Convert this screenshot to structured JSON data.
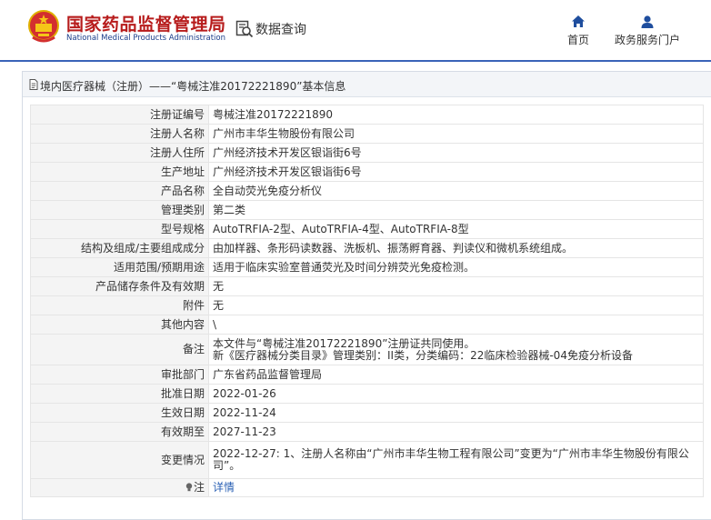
{
  "header": {
    "site_title": "国家药品监督管理局",
    "site_subtitle": "National Medical Products Administration",
    "query_label": "数据查询",
    "nav": [
      {
        "label": "首页",
        "icon": "home-icon"
      },
      {
        "label": "政务服务门户",
        "icon": "user-icon"
      }
    ],
    "accent_color": "#3a63b8",
    "brand_color": "#b71c1c"
  },
  "breadcrumb": "境内医疗器械（注册）——“粤械注准20172221890”基本信息",
  "rows": [
    {
      "label": "注册证编号",
      "value": "粤械注准20172221890"
    },
    {
      "label": "注册人名称",
      "value": "广州市丰华生物股份有限公司"
    },
    {
      "label": "注册人住所",
      "value": "广州经济技术开发区银诣街6号"
    },
    {
      "label": "生产地址",
      "value": "广州经济技术开发区银诣街6号"
    },
    {
      "label": "产品名称",
      "value": "全自动荧光免疫分析仪"
    },
    {
      "label": "管理类别",
      "value": "第二类"
    },
    {
      "label": "型号规格",
      "value": "AutoTRFIA-2型、AutoTRFIA-4型、AutoTRFIA-8型"
    },
    {
      "label": "结构及组成/主要组成成分",
      "value": "由加样器、条形码读数器、洗板机、振荡孵育器、判读仪和微机系统组成。"
    },
    {
      "label": "适用范围/预期用途",
      "value": "适用于临床实验室普通荧光及时间分辨荧光免疫检测。"
    },
    {
      "label": "产品储存条件及有效期",
      "value": "无"
    },
    {
      "label": "附件",
      "value": "无"
    },
    {
      "label": "其他内容",
      "value": "\\"
    }
  ],
  "note": {
    "label": "备注",
    "line1": "本文件与“粤械注准20172221890”注册证共同使用。",
    "line2": "新《医疗器械分类目录》管理类别：II类，分类编码：22临床检验器械-04免疫分析设备"
  },
  "rows2": [
    {
      "label": "审批部门",
      "value": "广东省药品监督管理局"
    },
    {
      "label": "批准日期",
      "value": "2022-01-26"
    },
    {
      "label": "生效日期",
      "value": "2022-11-24"
    },
    {
      "label": "有效期至",
      "value": "2027-11-23"
    }
  ],
  "change": {
    "label": "变更情况",
    "value": "2022-12-27: 1、注册人名称由“广州市丰华生物工程有限公司”变更为“广州市丰华生物股份有限公司”。"
  },
  "remark": {
    "label": "注",
    "link_label": "详情",
    "icon": "bulb-icon"
  }
}
